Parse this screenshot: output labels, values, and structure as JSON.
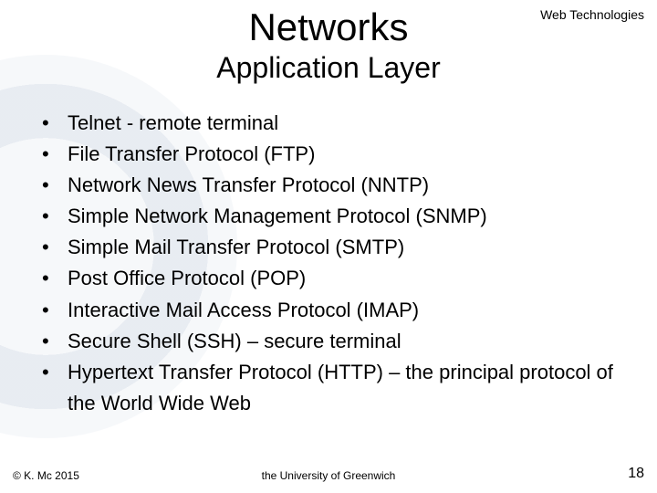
{
  "header": {
    "course_label": "Web Technologies",
    "title": "Networks",
    "subtitle": "Application Layer"
  },
  "bullets": [
    "Telnet - remote terminal",
    "File Transfer Protocol (FTP)",
    "Network News Transfer Protocol (NNTP)",
    "Simple Network Management Protocol (SNMP)",
    "Simple Mail Transfer Protocol (SMTP)",
    "Post Office Protocol (POP)",
    "Interactive Mail Access Protocol (IMAP)",
    "Secure Shell (SSH) – secure terminal",
    "Hypertext Transfer Protocol (HTTP) – the principal protocol of the World Wide Web"
  ],
  "footer": {
    "copyright": "© K. Mc 2015",
    "organization": "the University of Greenwich",
    "page_number": "18"
  }
}
